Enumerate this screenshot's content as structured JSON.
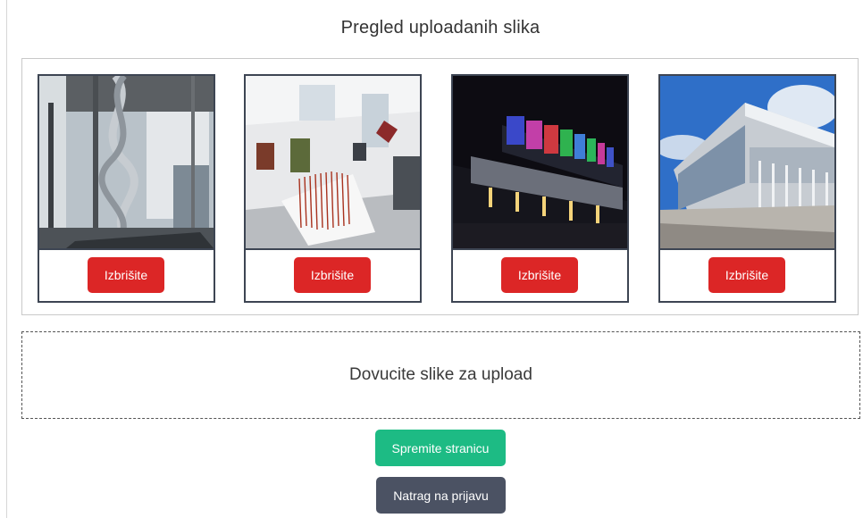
{
  "header": {
    "title": "Pregled uploadanih slika"
  },
  "gallery": {
    "images": [
      {
        "subject": "museum-interior-sculpture",
        "delete_label": "Izbrišite"
      },
      {
        "subject": "gallery-hall-artworks",
        "delete_label": "Izbrišite"
      },
      {
        "subject": "museum-night-facade",
        "delete_label": "Izbrišite"
      },
      {
        "subject": "museum-exterior-day",
        "delete_label": "Izbrišite"
      }
    ]
  },
  "dropzone": {
    "label": "Dovucite slike za upload"
  },
  "actions": {
    "save_label": "Spremite stranicu",
    "back_label": "Natrag na prijavu"
  },
  "colors": {
    "delete": "#dc2626",
    "save": "#1dbb84",
    "back": "#4b5263",
    "card_border": "#3d4553"
  }
}
